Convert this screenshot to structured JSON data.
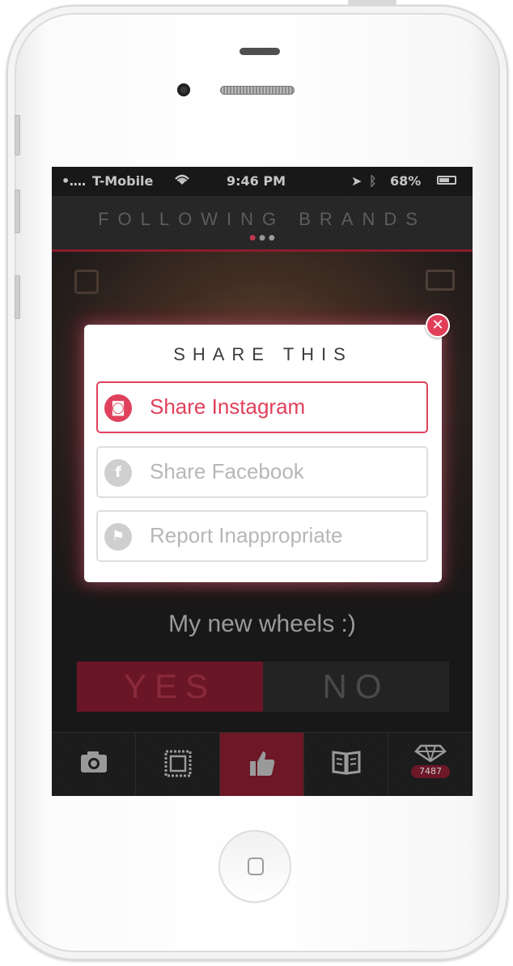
{
  "status_bar": {
    "signal": "•....",
    "carrier": "T-Mobile",
    "wifi_icon": "wifi-icon",
    "time": "9:46 PM",
    "location_icon": "location-arrow-icon",
    "bluetooth_icon": "bluetooth-icon",
    "battery_percent": "68%",
    "battery_level": 0.68
  },
  "nav": {
    "title": "FOLLOWING BRANDS",
    "page_dots_total": 3,
    "page_dots_active": 1
  },
  "post": {
    "caption": "My new wheels :)"
  },
  "vote": {
    "yes_label": "YES",
    "no_label": "NO",
    "selected": "yes"
  },
  "modal": {
    "title": "SHARE THIS",
    "buttons": [
      {
        "label": "Share Instagram",
        "icon": "instagram-icon",
        "highlighted": true
      },
      {
        "label": "Share Facebook",
        "icon": "facebook-icon",
        "highlighted": false
      },
      {
        "label": "Report Inappropriate",
        "icon": "flag-icon",
        "highlighted": false
      }
    ],
    "close_icon": "close-icon"
  },
  "tabbar": {
    "tabs": [
      {
        "icon": "camera-icon",
        "active": false
      },
      {
        "icon": "stamp-icon",
        "active": false
      },
      {
        "icon": "thumbs-up-icon",
        "active": true
      },
      {
        "icon": "book-icon",
        "active": false
      },
      {
        "icon": "gem-icon",
        "active": false,
        "badge": "7487"
      }
    ]
  },
  "colors": {
    "accent": "#e0415c",
    "dark_accent": "#6d1727",
    "background": "#191818"
  }
}
